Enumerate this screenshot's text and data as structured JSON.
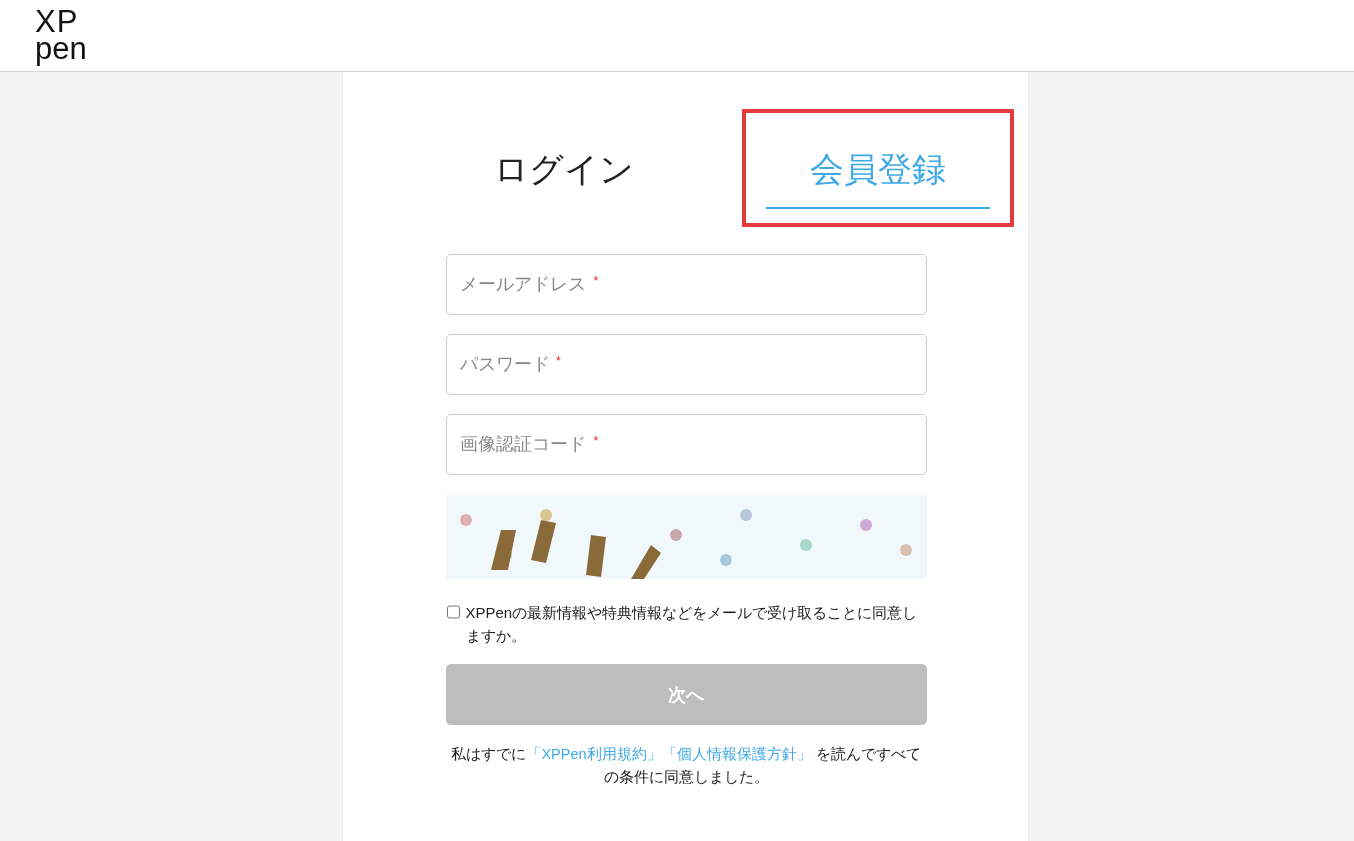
{
  "logo": {
    "lines": [
      "XP",
      "pen"
    ]
  },
  "tabs": [
    {
      "label": "ログイン",
      "selected": false,
      "highlighted": false
    },
    {
      "label": "会員登録",
      "selected": true,
      "highlighted": true
    }
  ],
  "fields": [
    {
      "placeholder": "メールアドレス",
      "required_mark": "*"
    },
    {
      "placeholder": "パスワード",
      "required_mark": "*"
    },
    {
      "placeholder": "画像認証コード",
      "required_mark": "*"
    }
  ],
  "newsletter": {
    "label": "XPPenの最新情報や特典情報などをメールで受け取ることに同意しますか。",
    "checked": false
  },
  "next_button": {
    "label": "次へ",
    "disabled": true
  },
  "terms": [
    {
      "kind": "text",
      "text": "私はすでに"
    },
    {
      "kind": "link",
      "text": "「XPPen利用規約」"
    },
    {
      "kind": "link",
      "text": "「個人情報保護方針」"
    },
    {
      "kind": "text",
      "text": " を読んですべての条件に同意しました。"
    }
  ]
}
